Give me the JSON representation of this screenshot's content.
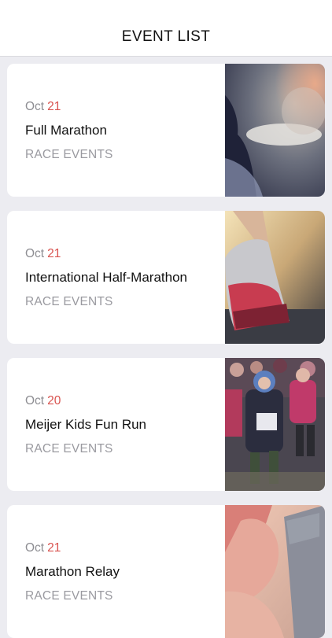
{
  "header": {
    "title": "EVENT LIST"
  },
  "events": [
    {
      "month": "Oct",
      "day": "21",
      "title": "Full Marathon",
      "category": "RACE EVENTS",
      "image": "runner-breath-photo"
    },
    {
      "month": "Oct",
      "day": "21",
      "title": "International Half-Marathon",
      "category": "RACE EVENTS",
      "image": "running-shoe-photo"
    },
    {
      "month": "Oct",
      "day": "20",
      "title": "Meijer Kids Fun Run",
      "category": "RACE EVENTS",
      "image": "kids-running-crowd-photo"
    },
    {
      "month": "Oct",
      "day": "21",
      "title": "Marathon Relay",
      "category": "RACE EVENTS",
      "image": "relay-baton-hands-photo"
    }
  ],
  "colors": {
    "accent_day": "#d9534f",
    "background": "#ececf1",
    "muted_text": "#8e8e93"
  }
}
